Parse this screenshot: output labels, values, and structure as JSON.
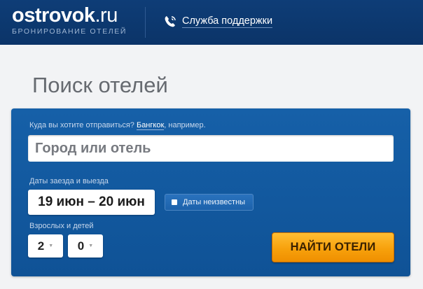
{
  "header": {
    "logo_main": "ostrovok",
    "logo_tld": ".ru",
    "logo_subtitle": "БРОНИРОВАНИЕ ОТЕЛЕЙ",
    "support_label": "Служба поддержки",
    "support_icon": "phone-icon"
  },
  "main": {
    "title": "Поиск отелей"
  },
  "search": {
    "hint_prefix": "Куда вы хотите отправиться?",
    "hint_example": "Бангкок",
    "hint_suffix": ", например.",
    "city_placeholder": "Город или отель",
    "dates_label": "Даты заезда и выезда",
    "dates_value": "19 июн – 20 июн",
    "dates_unknown_label": "Даты неизвестны",
    "guests_label": "Взрослых и детей",
    "adults": "2",
    "children": "0",
    "submit_label": "НАЙТИ ОТЕЛИ"
  },
  "colors": {
    "header_bg": "#0e3d77",
    "panel_bg": "#1660a8",
    "button_bg": "#f7a10c",
    "page_bg": "#f2f3f5"
  }
}
